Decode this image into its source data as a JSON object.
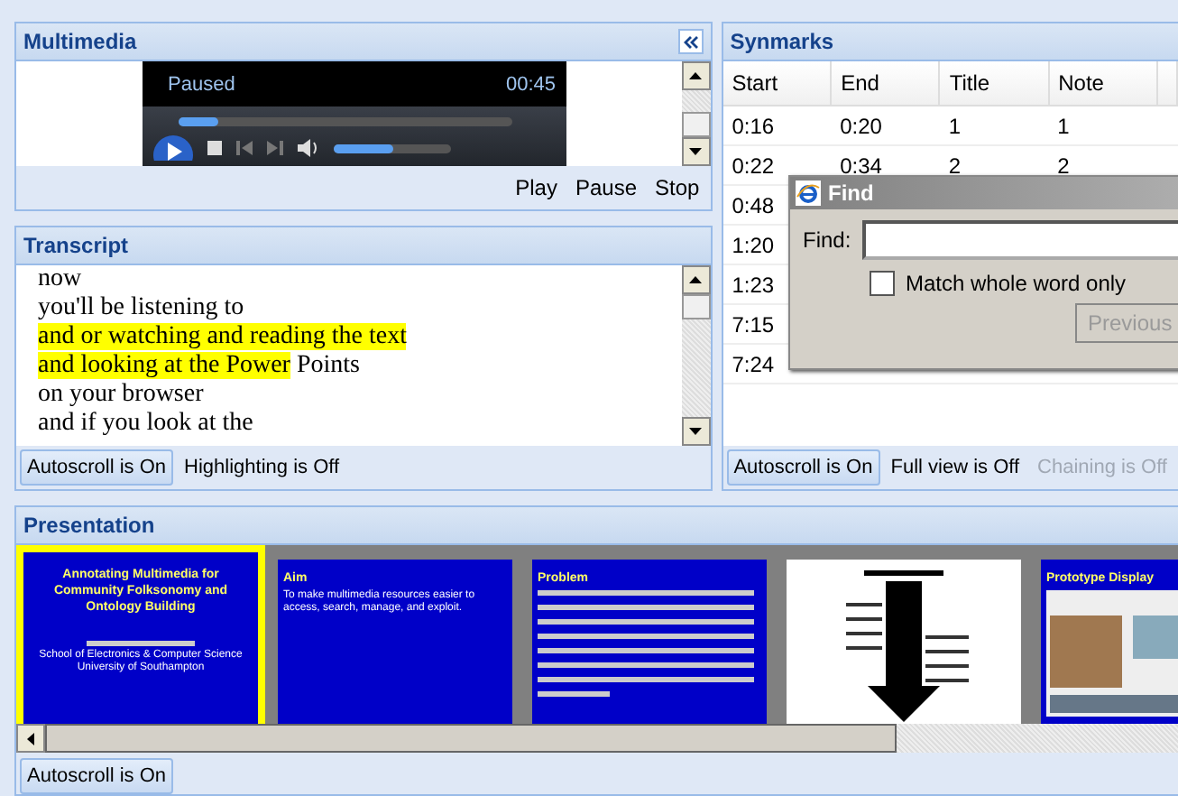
{
  "multimedia": {
    "title": "Multimedia",
    "player": {
      "status": "Paused",
      "time": "00:45",
      "seek": {
        "level": 0.12
      },
      "volume": {
        "level": 0.5
      }
    },
    "buttons": [
      "Play",
      "Pause",
      "Stop"
    ]
  },
  "transcript": {
    "title": "Transcript",
    "lines": [
      [
        {
          "text": "now",
          "highlighted": false
        }
      ],
      [
        {
          "text": "you'll be listening to",
          "highlighted": false
        }
      ],
      [
        {
          "text": "and or watching and reading the text",
          "highlighted": true
        }
      ],
      [
        {
          "text": "and looking at the Power",
          "highlighted": true
        },
        {
          "text": " Points",
          "highlighted": false
        }
      ],
      [
        {
          "text": "on your browser",
          "highlighted": false
        }
      ],
      [
        {
          "text": "and if you look at the",
          "highlighted": false
        }
      ]
    ],
    "toggles": [
      {
        "label": "Autoscroll is On",
        "on": true,
        "disabled": false
      },
      {
        "label": "Highlighting is Off",
        "on": false,
        "disabled": false
      }
    ]
  },
  "synmarks": {
    "title": "Synmarks",
    "columns": [
      "Start",
      "End",
      "Title",
      "Note"
    ],
    "rows": [
      {
        "start": "0:16",
        "end": "0:20",
        "title": "1",
        "note": "1"
      },
      {
        "start": "0:22",
        "end": "0:34",
        "title": "2",
        "note": "2"
      },
      {
        "start": "0:48"
      },
      {
        "start": "1:20"
      },
      {
        "start": "1:23"
      },
      {
        "start": "7:15"
      },
      {
        "start": "7:24"
      }
    ],
    "toggles": [
      {
        "label": "Autoscroll is On",
        "on": true,
        "disabled": false
      },
      {
        "label": "Full view is Off",
        "on": false,
        "disabled": false
      },
      {
        "label": "Chaining is Off",
        "on": false,
        "disabled": true
      }
    ]
  },
  "find_dialog": {
    "title": "Find",
    "label": "Find:",
    "match_whole_word": {
      "label": "Match whole word only",
      "checked": false
    },
    "button": "Previous"
  },
  "presentation": {
    "title": "Presentation",
    "slides": [
      {
        "kind": "title",
        "selected": true,
        "title": "Annotating Multimedia for Community Folksonomy and Ontology Building",
        "lines": [
          "School of Electronics & Computer Science",
          "University of Southampton"
        ]
      },
      {
        "kind": "text",
        "selected": false,
        "title": "Aim",
        "lines": [
          "To make multimedia resources easier to access, search, manage, and exploit."
        ]
      },
      {
        "kind": "text",
        "selected": false,
        "title": "Problem"
      },
      {
        "kind": "diagram",
        "selected": false
      },
      {
        "kind": "screenshot",
        "selected": false,
        "title": "Prototype Display"
      }
    ],
    "toggles": [
      {
        "label": "Autoscroll is On",
        "on": true,
        "disabled": false
      }
    ]
  }
}
